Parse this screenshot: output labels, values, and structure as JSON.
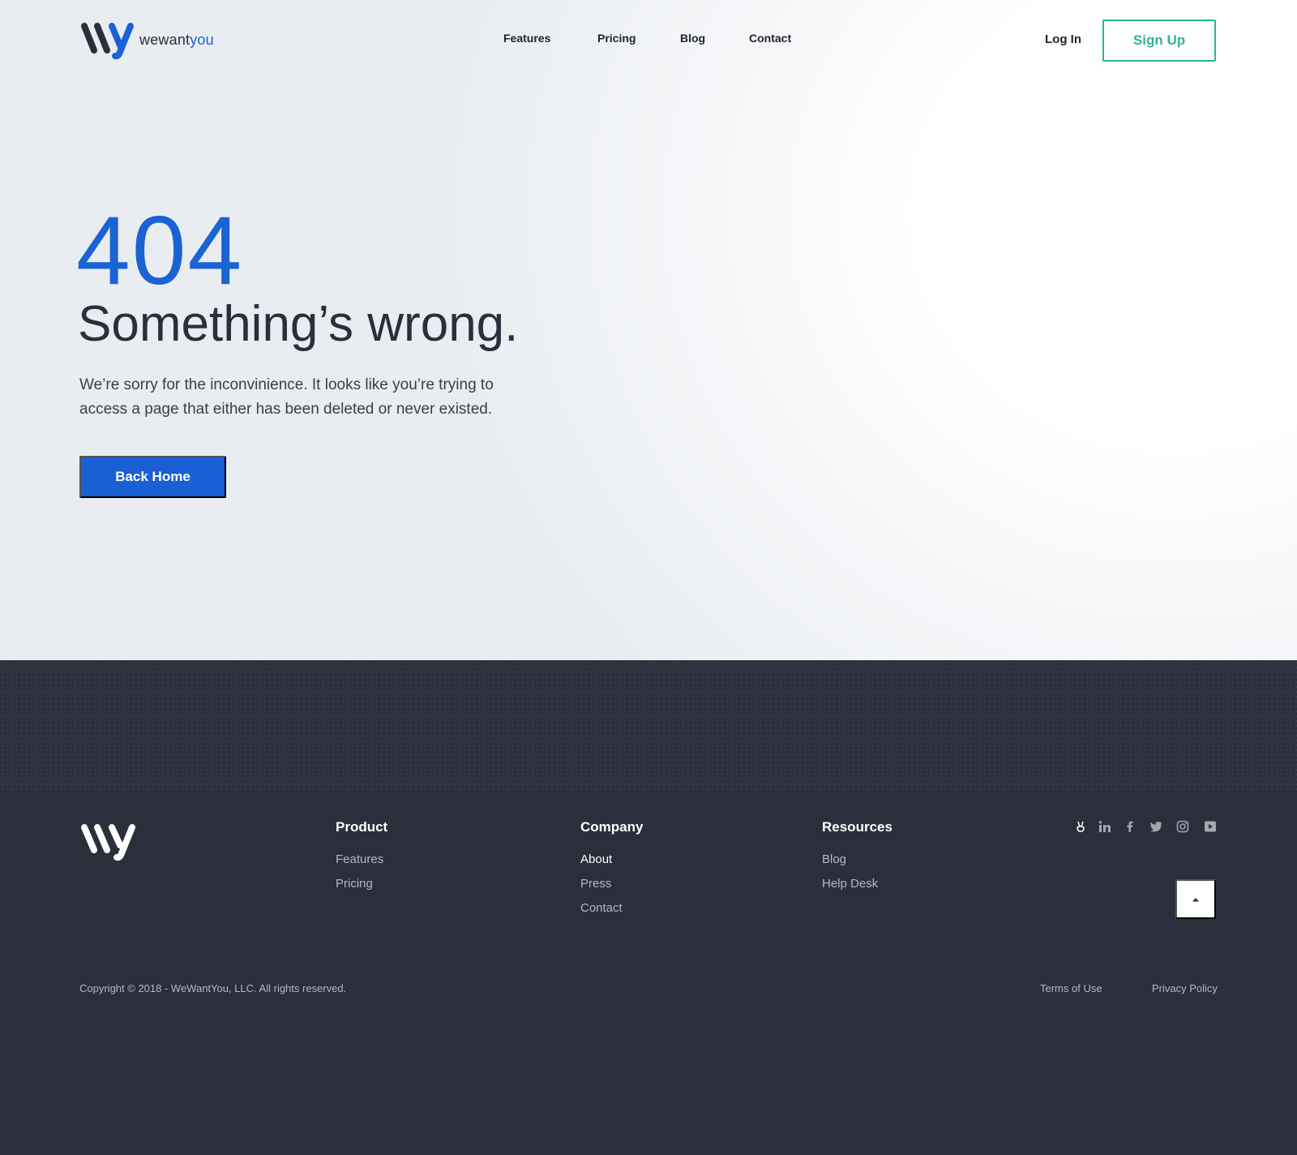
{
  "header": {
    "logo_text_main": "wewant",
    "logo_text_accent": "you",
    "nav": [
      "Features",
      "Pricing",
      "Blog",
      "Contact"
    ],
    "login_label": "Log In",
    "signup_label": "Sign Up"
  },
  "error": {
    "code": "404",
    "title": "Something’s wrong.",
    "description": "We’re sorry for the inconvinience. It looks like you’re trying to access a page that either has been deleted or never existed.",
    "button_label": "Back Home"
  },
  "footer": {
    "columns": [
      {
        "title": "Product",
        "links": [
          "Features",
          "Pricing"
        ]
      },
      {
        "title": "Company",
        "links": [
          "About",
          "Press",
          "Contact"
        ]
      },
      {
        "title": "Resources",
        "links": [
          "Blog",
          "Help Desk"
        ]
      }
    ],
    "socials": [
      "angellist-icon",
      "linkedin-icon",
      "facebook-icon",
      "twitter-icon",
      "instagram-icon",
      "youtube-icon"
    ],
    "copyright": "Copyright © 2018 - WeWantYou, LLC. All rights reserved.",
    "terms_label": "Terms of Use",
    "privacy_label": "Privacy Policy"
  },
  "colors": {
    "brand_blue": "#1a63d4",
    "signup_green": "#2bb594",
    "footer_bg": "#2b2f3b"
  }
}
